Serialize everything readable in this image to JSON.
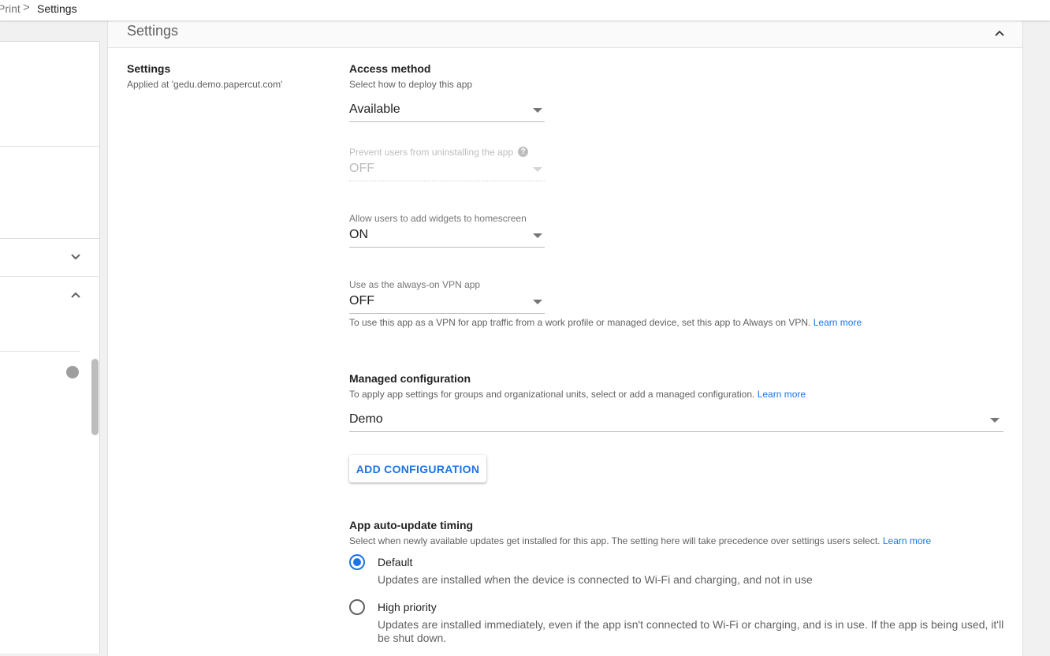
{
  "breadcrumb": {
    "previous": "Print",
    "separator": ">",
    "current": "Settings"
  },
  "card": {
    "title": "Settings",
    "section_title": "Settings",
    "section_subtitle": "Applied at 'gedu.demo.papercut.com'"
  },
  "access_method": {
    "label": "Access method",
    "help": "Select how to deploy this app",
    "value": "Available"
  },
  "prevent_uninstall": {
    "label": "Prevent users from uninstalling the app",
    "value": "OFF",
    "disabled": true,
    "icon": "help-icon"
  },
  "widgets": {
    "label": "Allow users to add widgets to homescreen",
    "value": "ON"
  },
  "vpn": {
    "label": "Use as the always-on VPN app",
    "value": "OFF",
    "help": "To use this app as a VPN for app traffic from a work profile or managed device, set this app to Always on VPN.",
    "learn_more": "Learn more"
  },
  "managed_config": {
    "label": "Managed configuration",
    "help": "To apply app settings for groups and organizational units, select or add a managed configuration.",
    "learn_more": "Learn more",
    "value": "Demo",
    "add_button": "ADD CONFIGURATION"
  },
  "auto_update": {
    "label": "App auto-update timing",
    "help": "Select when newly available updates get installed for this app. The setting here will take precedence over settings users select.",
    "learn_more": "Learn more",
    "options": [
      {
        "label": "Default",
        "description": "Updates are installed when the device is connected to Wi-Fi and charging, and not in use",
        "checked": true
      },
      {
        "label": "High priority",
        "description": "Updates are installed immediately, even if the app isn't connected to Wi-Fi or charging, and is in use. If the app is being used, it'll be shut down.",
        "checked": false
      }
    ]
  },
  "colors": {
    "accent": "#1a73e8",
    "text": "#212121",
    "muted": "#616161"
  }
}
